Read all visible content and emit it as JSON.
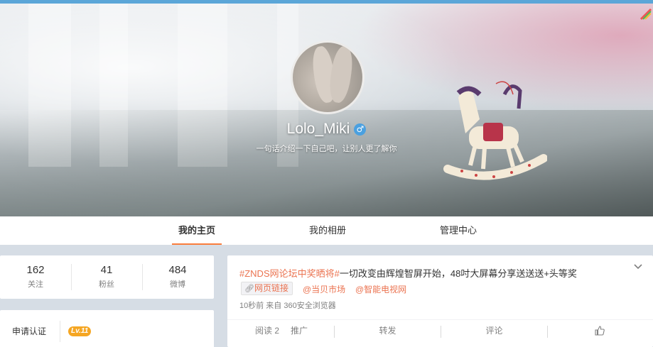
{
  "profile": {
    "username": "Lolo_Miki",
    "gender_icon": "male-icon",
    "bio": "一句话介绍一下自己吧，让别人更了解你"
  },
  "nav": {
    "tabs": [
      {
        "label": "我的主页",
        "active": true
      },
      {
        "label": "我的相册",
        "active": false
      },
      {
        "label": "管理中心",
        "active": false
      }
    ]
  },
  "stats": {
    "following": {
      "value": "162",
      "label": "关注"
    },
    "followers": {
      "value": "41",
      "label": "粉丝"
    },
    "posts": {
      "value": "484",
      "label": "微博"
    }
  },
  "verify": {
    "label": "申请认证",
    "level": "Lv.11"
  },
  "post": {
    "hashtag": "#ZNDS网论坛中奖晒将#",
    "text": "一切改变由辉煌智屏开始，48吋大屏幕分享送送送+头等奖",
    "link_label": "网页链接",
    "mention1": "@当贝市场",
    "mention2": "@智能电视网",
    "meta": "10秒前 来自 360安全浏览器",
    "actions": {
      "read": "阅读 2",
      "promote": "推广",
      "repost": "转发",
      "comment": "评论"
    }
  },
  "colors": {
    "accent": "#fa7d3c",
    "link": "#eb7350",
    "topbar": "#5ba6d8",
    "level_badge": "#f5a623"
  }
}
